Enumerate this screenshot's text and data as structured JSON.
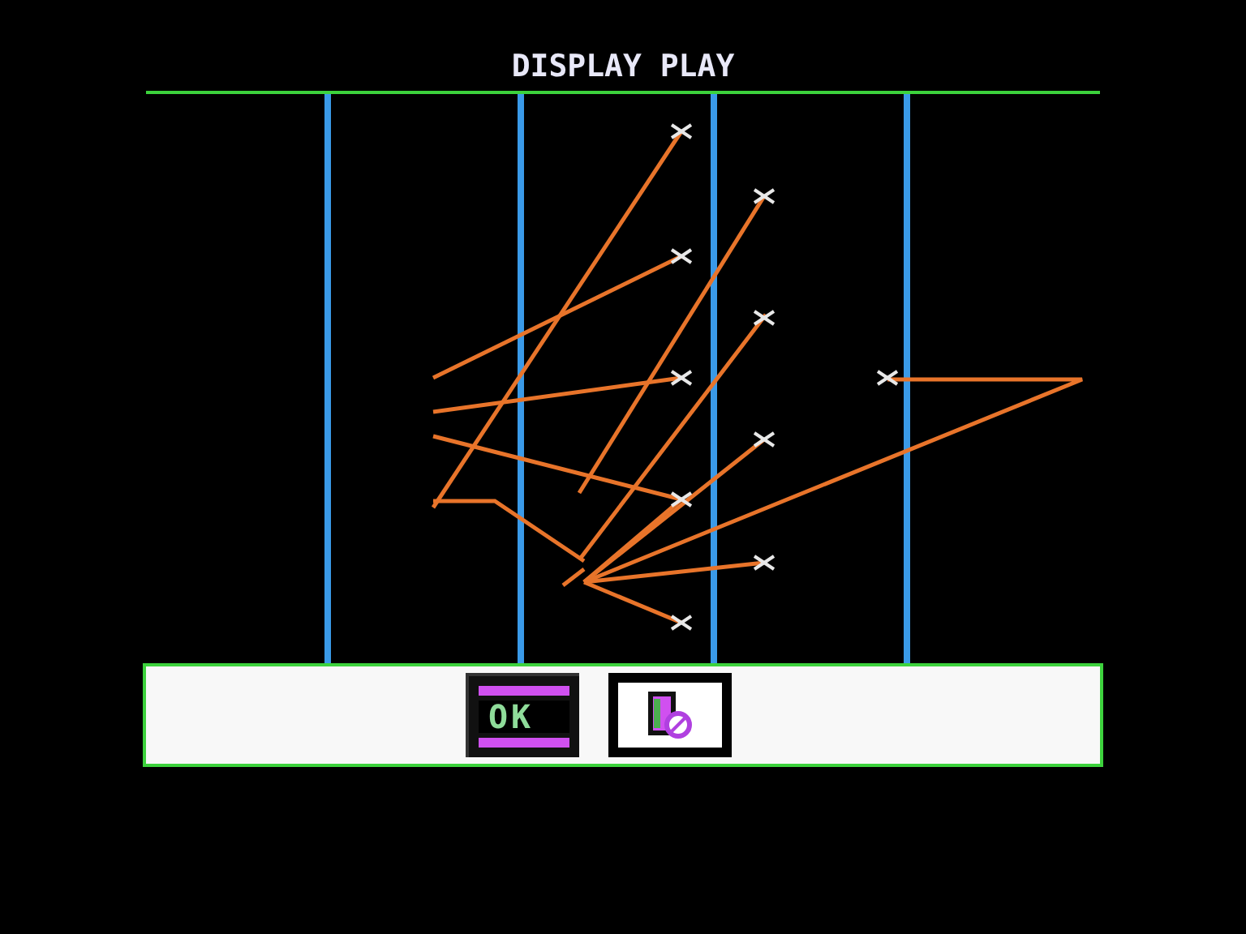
{
  "title": "DISPLAY PLAY",
  "buttons": [
    {
      "kind": "text",
      "label": "OK"
    },
    {
      "kind": "icon"
    }
  ]
}
